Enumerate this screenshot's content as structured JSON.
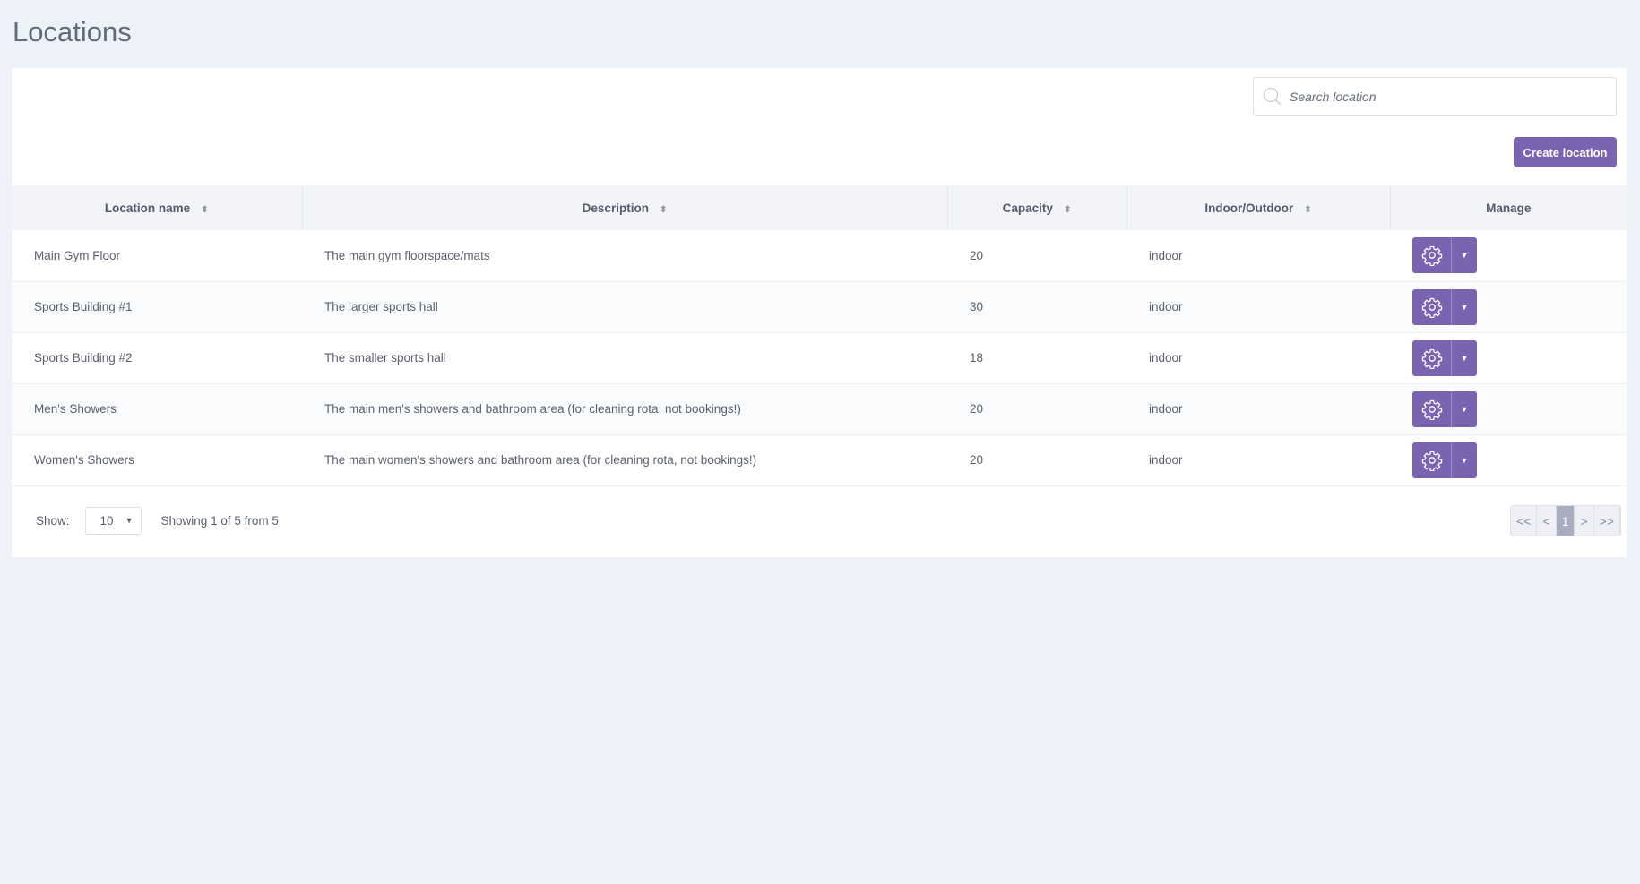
{
  "page": {
    "title": "Locations"
  },
  "search": {
    "placeholder": "Search location"
  },
  "toolbar": {
    "create_label": "Create location"
  },
  "table": {
    "columns": [
      {
        "label": "Location name",
        "sortable": true
      },
      {
        "label": "Description",
        "sortable": true
      },
      {
        "label": "Capacity",
        "sortable": true
      },
      {
        "label": "Indoor/Outdoor",
        "sortable": true
      },
      {
        "label": "Manage",
        "sortable": false
      }
    ],
    "rows": [
      {
        "name": "Main Gym Floor",
        "description": "The main gym floorspace/mats",
        "capacity": "20",
        "type": "indoor"
      },
      {
        "name": "Sports Building #1",
        "description": "The larger sports hall",
        "capacity": "30",
        "type": "indoor"
      },
      {
        "name": "Sports Building #2",
        "description": "The smaller sports hall",
        "capacity": "18",
        "type": "indoor"
      },
      {
        "name": "Men's Showers",
        "description": "The main men's showers and bathroom area (for cleaning rota, not bookings!)",
        "capacity": "20",
        "type": "indoor"
      },
      {
        "name": "Women's Showers",
        "description": "The main women's showers and bathroom area (for cleaning rota, not bookings!)",
        "capacity": "20",
        "type": "indoor"
      }
    ]
  },
  "footer": {
    "show_label": "Show:",
    "page_size": "10",
    "summary": "Showing 1 of 5 from 5"
  },
  "pagination": {
    "first": "<<",
    "prev": "<",
    "current": "1",
    "next": ">",
    "last": ">>"
  },
  "colors": {
    "accent": "#7a63b1",
    "background": "#edf1f8"
  }
}
